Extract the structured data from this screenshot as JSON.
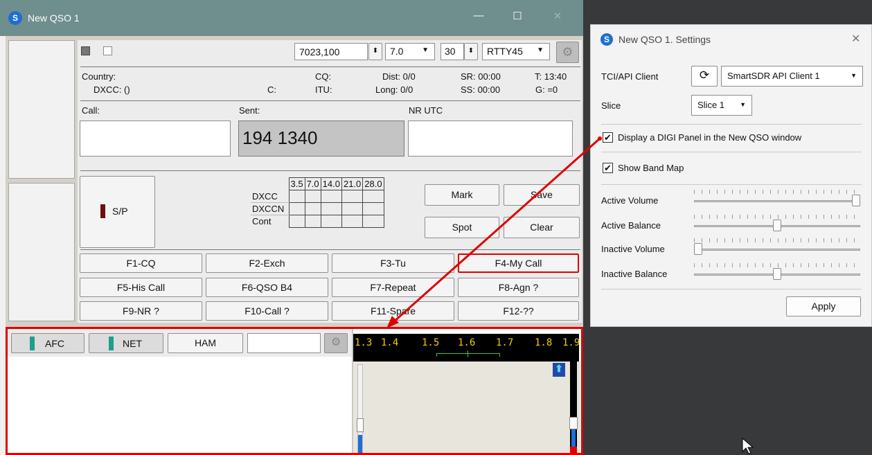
{
  "main_window": {
    "title": "New QSO 1",
    "minimize": "—",
    "maximize": "☐",
    "close": "✕"
  },
  "top_row": {
    "frequency": "7023,100",
    "band": "7.0",
    "number": "30",
    "mode": "RTTY45"
  },
  "info": {
    "country": "Country:",
    "dxcc": "DXCC: ()",
    "cq": "CQ:",
    "c": "C:",
    "itu": "ITU:",
    "dist": "Dist: 0/0",
    "long": "Long: 0/0",
    "sr": "SR: 00:00",
    "ss": "SS: 00:00",
    "t": "T: 13:40",
    "g": "G: =0"
  },
  "call_row": {
    "call_label": "Call:",
    "sent_label": "Sent:",
    "sent_value": "194 1340",
    "nr_utc_label": "NR UTC"
  },
  "sp_button": "S/P",
  "band_grid": {
    "headers": [
      "3.5",
      "7.0",
      "14.0",
      "21.0",
      "28.0"
    ],
    "rows": [
      "DXCC",
      "DXCCN",
      "Cont"
    ]
  },
  "actions": {
    "mark": "Mark",
    "save": "Save",
    "spot": "Spot",
    "clear": "Clear"
  },
  "fkeys": [
    "F1-CQ",
    "F2-Exch",
    "F3-Tu",
    "F4-My Call",
    "F5-His Call",
    "F6-QSO B4",
    "F7-Repeat",
    "F8-Agn ?",
    "F9-NR ?",
    "F10-Call ?",
    "F11-Spare",
    "F12-??"
  ],
  "digi": {
    "afc": "AFC",
    "net": "NET",
    "ham": "HAM",
    "scale": [
      "1.3",
      "1.4",
      "1.5",
      "1.6",
      "1.7",
      "1.8",
      "1.9"
    ]
  },
  "settings": {
    "title": "New QSO 1. Settings",
    "close": "✕",
    "tci_label": "TCI/API Client",
    "tci_value": "SmartSDR API Client 1",
    "slice_label": "Slice",
    "slice_value": "Slice 1",
    "digi_panel": "Display a DIGI Panel in the New QSO window",
    "band_map": "Show Band Map",
    "active_volume": "Active Volume",
    "active_balance": "Active Balance",
    "inactive_volume": "Inactive Volume",
    "inactive_balance": "Inactive Balance",
    "apply": "Apply",
    "levels": {
      "active_volume": 1.0,
      "active_balance": 0.5,
      "inactive_volume": 0.0,
      "inactive_balance": 0.5
    }
  },
  "colors": {
    "titlebar": "#6f8e8e",
    "highlight": "#e00000",
    "brand": "#1e6fd0"
  }
}
